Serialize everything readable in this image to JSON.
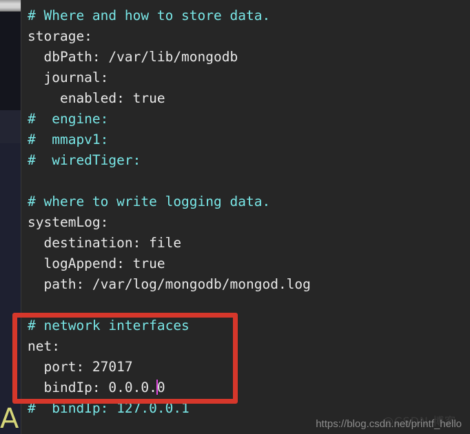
{
  "editor": {
    "language": "yaml",
    "file_hint": "mongod.conf",
    "background_color": "#262626",
    "comment_color": "#79e6e6",
    "text_color": "#e8e8e8",
    "caret_color": "#e24ae2",
    "lines": [
      {
        "text": "# Where and how to store data.",
        "kind": "comment"
      },
      {
        "text": "storage:",
        "kind": "text"
      },
      {
        "text": "  dbPath: /var/lib/mongodb",
        "kind": "text"
      },
      {
        "text": "  journal:",
        "kind": "text"
      },
      {
        "text": "    enabled: true",
        "kind": "text"
      },
      {
        "text": "#  engine:",
        "kind": "comment"
      },
      {
        "text": "#  mmapv1:",
        "kind": "comment"
      },
      {
        "text": "#  wiredTiger:",
        "kind": "comment"
      },
      {
        "text": "",
        "kind": "blank"
      },
      {
        "text": "# where to write logging data.",
        "kind": "comment"
      },
      {
        "text": "systemLog:",
        "kind": "text"
      },
      {
        "text": "  destination: file",
        "kind": "text"
      },
      {
        "text": "  logAppend: true",
        "kind": "text"
      },
      {
        "text": "  path: /var/log/mongodb/mongod.log",
        "kind": "text"
      },
      {
        "text": "",
        "kind": "blank"
      },
      {
        "text": "# network interfaces",
        "kind": "comment"
      },
      {
        "text": "net:",
        "kind": "text"
      },
      {
        "text": "  port: 27017",
        "kind": "text"
      },
      {
        "text": "  bindIp: 0.0.0.0",
        "kind": "text",
        "caret_after": "  bindIp: 0.0.0."
      },
      {
        "text": "#  bindIp: 127.0.0.1",
        "kind": "comment"
      }
    ],
    "caret": {
      "line_index": 18,
      "before_text": "  bindIp: 0.0.0.",
      "after_text": "0"
    }
  },
  "annotation": {
    "type": "rectangle-highlight",
    "color": "#d6372b",
    "covers_lines": [
      "# network interfaces",
      "net:",
      "  port: 27017",
      "  bindIp: 0.0.0.0"
    ]
  },
  "gutter": {
    "label": "minimap-strip",
    "segments": [
      "scrollbar-thumb",
      "dark-block",
      "mid-block",
      "base-block"
    ]
  },
  "stray_glyph": {
    "text": "A",
    "color": "#d5d57a"
  },
  "watermark": {
    "url": "https://blog.csdn.net/printf_hello",
    "overlay": "@CSDN 博客"
  }
}
